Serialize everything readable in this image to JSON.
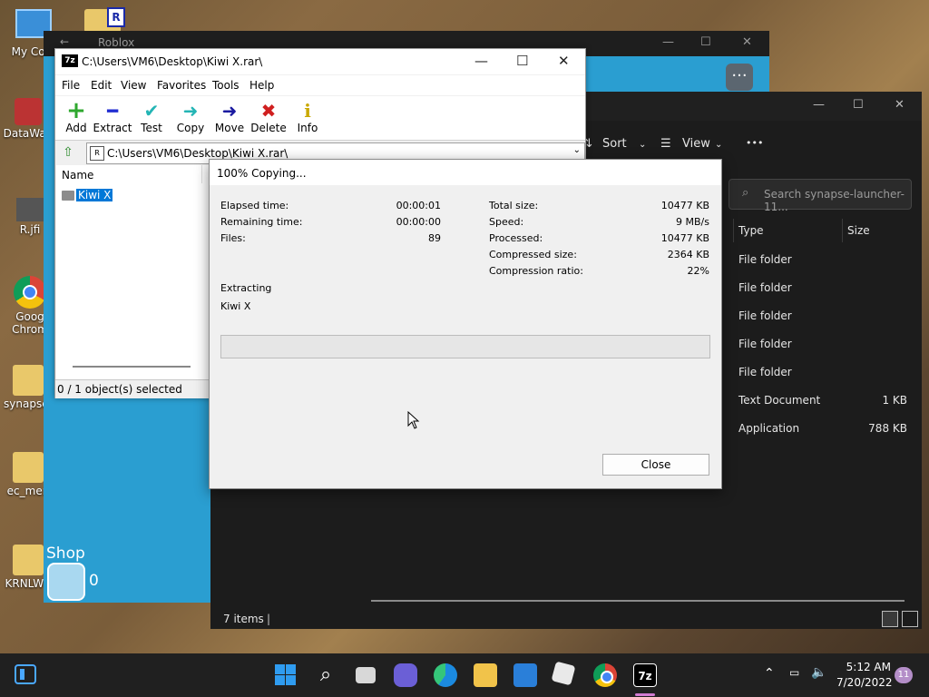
{
  "desktop": {
    "icons": [
      {
        "label": "My Com"
      },
      {
        "label": "DataWag"
      },
      {
        "label": "R.jfi"
      },
      {
        "label": "Goog Chrom"
      },
      {
        "label": "synapse-"
      },
      {
        "label": "ec_men"
      },
      {
        "label": "KRNLWR"
      }
    ],
    "roblox_folder_badge": "R"
  },
  "roblox": {
    "title": "Roblox",
    "shop_label": "Shop",
    "coins": "0"
  },
  "explorer": {
    "sort_label": "Sort",
    "view_label": "View",
    "more_label": "•••",
    "search_placeholder": "Search synapse-launcher-11...",
    "columns": {
      "type": "Type",
      "size": "Size"
    },
    "rows": [
      {
        "type": "File folder",
        "size": ""
      },
      {
        "type": "File folder",
        "size": ""
      },
      {
        "type": "File folder",
        "size": ""
      },
      {
        "type": "File folder",
        "size": ""
      },
      {
        "type": "File folder",
        "size": ""
      },
      {
        "type": "Text Document",
        "size": "1 KB"
      },
      {
        "type": "Application",
        "size": "788 KB"
      }
    ],
    "status": "7 items"
  },
  "sevenzip": {
    "logo": "7z",
    "title": "C:\\Users\\VM6\\Desktop\\Kiwi X.rar\\",
    "menu": [
      "File",
      "Edit",
      "View",
      "Favorites",
      "Tools",
      "Help"
    ],
    "tools": [
      {
        "label": "Add",
        "icon": "+",
        "color": "#2fa82f"
      },
      {
        "label": "Extract",
        "icon": "━",
        "color": "#1f2bd1"
      },
      {
        "label": "Test",
        "icon": "✔",
        "color": "#24b5b5"
      },
      {
        "label": "Copy",
        "icon": "➜",
        "color": "#24b5b5"
      },
      {
        "label": "Move",
        "icon": "➜",
        "color": "#1a1aa0"
      },
      {
        "label": "Delete",
        "icon": "✖",
        "color": "#d01f1f"
      },
      {
        "label": "Info",
        "icon": "i",
        "color": "#c9a800"
      }
    ],
    "address": "C:\\Users\\VM6\\Desktop\\Kiwi X.rar\\",
    "list_header": "Name",
    "list_item": "Kiwi X",
    "status": "0 / 1 object(s) selected"
  },
  "dialog": {
    "title": "100% Copying...",
    "left_stats": [
      {
        "label": "Elapsed time:",
        "value": "00:00:01"
      },
      {
        "label": "Remaining time:",
        "value": "00:00:00"
      },
      {
        "label": "Files:",
        "value": "89"
      }
    ],
    "right_stats": [
      {
        "label": "Total size:",
        "value": "10477 KB"
      },
      {
        "label": "Speed:",
        "value": "9 MB/s"
      },
      {
        "label": "Processed:",
        "value": "10477 KB"
      },
      {
        "label": "Compressed size:",
        "value": "2364 KB"
      },
      {
        "label": "Compression ratio:",
        "value": "22%"
      }
    ],
    "operation": "Extracting",
    "current_item": "Kiwi X",
    "progress": 1.0,
    "close_label": "Close"
  },
  "taskbar": {
    "time": "5:12 AM",
    "date": "7/20/2022",
    "notification_count": "11",
    "sevenzip_label": "7z"
  },
  "colors": {
    "accent": "#0078d7",
    "roblox_blue": "#2a9ed1",
    "explorer_bg": "#1c1c1c",
    "taskbar_bg": "#202020"
  }
}
